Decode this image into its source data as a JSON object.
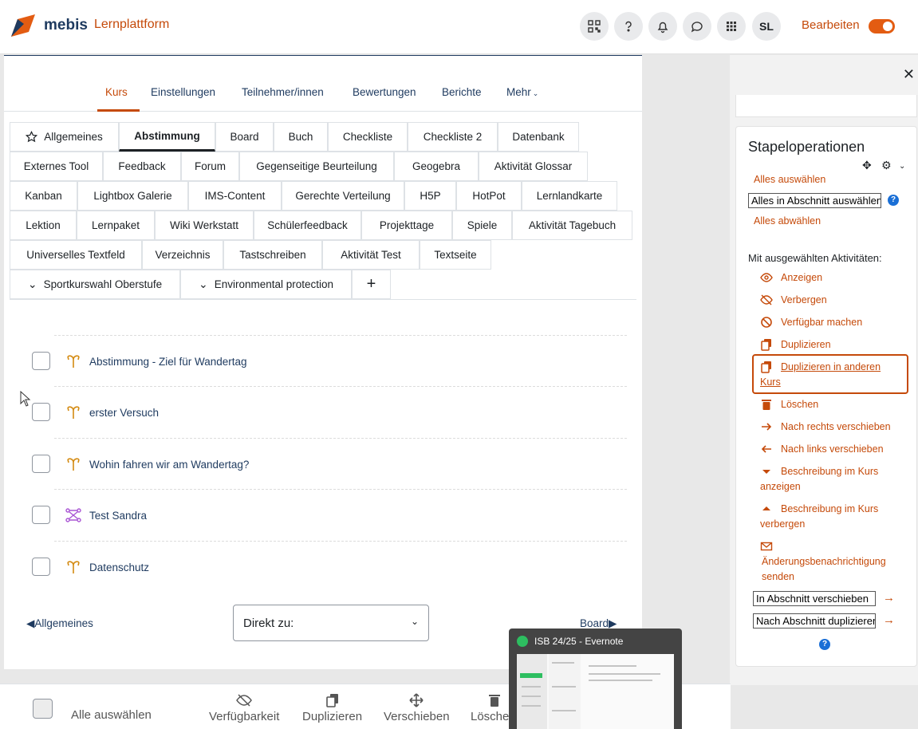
{
  "header": {
    "brand": "mebis",
    "platform": "Lernplattform",
    "avatar_initials": "SL",
    "edit_label": "Bearbeiten",
    "edit_mode_on": true,
    "accent_color": "#c54a0a"
  },
  "course_nav": {
    "items": [
      "Kurs",
      "Einstellungen",
      "Teilnehmer/innen",
      "Bewertungen",
      "Berichte",
      "Mehr"
    ],
    "active": "Kurs"
  },
  "section_tabs": {
    "rows": [
      [
        "Allgemeines",
        "Abstimmung",
        "Board",
        "Buch",
        "Checkliste",
        "Checkliste 2",
        "Datenbank"
      ],
      [
        "Externes Tool",
        "Feedback",
        "Forum",
        "Gegenseitige Beurteilung",
        "Geogebra",
        "Aktivität Glossar"
      ],
      [
        "Kanban",
        "Lightbox Galerie",
        "IMS-Content",
        "Gerechte Verteilung",
        "H5P",
        "HotPot",
        "Lernlandkarte"
      ],
      [
        "Lektion",
        "Lernpaket",
        "Wiki Werkstatt",
        "Schülerfeedback",
        "Projekttage",
        "Spiele",
        "Aktivität Tagebuch"
      ],
      [
        "Universelles Textfeld",
        "Verzeichnis",
        "Tastschreiben",
        "Aktivität Test",
        "Textseite"
      ],
      [
        "Sportkurswahl Oberstufe",
        "Environmental protection",
        "+"
      ]
    ],
    "active": "Abstimmung"
  },
  "activities": [
    {
      "name": "Abstimmung - Ziel für Wandertag",
      "icon": "choice-icon"
    },
    {
      "name": "erster Versuch",
      "icon": "choice-icon"
    },
    {
      "name": "Wohin fahren wir am Wandertag?",
      "icon": "choice-icon"
    },
    {
      "name": "Test Sandra",
      "icon": "workflow-icon"
    },
    {
      "name": "Datenschutz",
      "icon": "choice-icon"
    }
  ],
  "section_nav": {
    "prev": "◀Allgemeines",
    "next": "Board▶",
    "jump_label": "Direkt zu:"
  },
  "bulk_panel": {
    "title": "Stapeloperationen",
    "select_all": "Alles auswählen",
    "select_in_section": "Alles in Abschnitt auswählen",
    "deselect_all": "Alles abwählen",
    "with_selected": "Mit ausgewählten Aktivitäten:",
    "actions": [
      {
        "label": "Anzeigen",
        "icon": "eye-icon"
      },
      {
        "label": "Verbergen",
        "icon": "eye-slash-icon"
      },
      {
        "label": "Verfügbar machen",
        "icon": "ban-icon"
      },
      {
        "label": "Duplizieren",
        "icon": "copy-icon"
      },
      {
        "label": "Duplizieren in anderen Kurs",
        "icon": "copy-icon"
      },
      {
        "label": "Löschen",
        "icon": "trash-icon"
      },
      {
        "label": "Nach rechts verschieben",
        "icon": "arrow-right-icon"
      },
      {
        "label": "Nach links verschieben",
        "icon": "arrow-left-icon"
      },
      {
        "label": "Beschreibung im Kurs anzeigen",
        "icon": "caret-down-icon"
      },
      {
        "label": "Beschreibung im Kurs verbergen",
        "icon": "caret-up-icon"
      },
      {
        "label": "Änderungsbenachrichtigung senden",
        "icon": "envelope-icon"
      }
    ],
    "move_select": "In Abschnitt verschieben",
    "duplicate_select": "Nach Abschnitt duplizieren"
  },
  "bottom_bar": {
    "select_all": "Alle auswählen",
    "items": [
      "Verfügbarkeit",
      "Duplizieren",
      "Verschieben",
      "Löschen"
    ]
  },
  "taskbar_preview": {
    "title": "ISB 24/25 - Evernote"
  }
}
